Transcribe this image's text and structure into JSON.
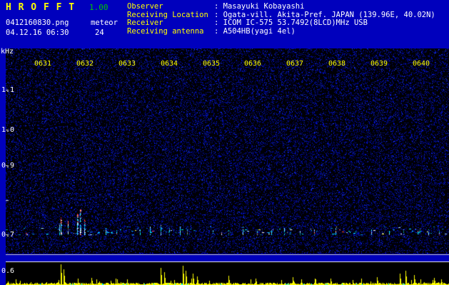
{
  "app": {
    "title": "H R O F F T",
    "version": "1.00",
    "filename": "0412160830.png",
    "mode_label": "meteor",
    "datetime": "04.12.16 06:30",
    "echo_count": "24"
  },
  "observer_info": {
    "rows": [
      {
        "label": "Observer",
        "value": ": Masayuki Kobayashi"
      },
      {
        "label": "Receiving Location",
        "value": ": Ogata-vill. Akita-Pref. JAPAN (139.96E, 40.02N)"
      },
      {
        "label": "Receiver",
        "value": ": ICOM IC-575 53.7492(8LCD)MHz USB"
      },
      {
        "label": "Receiving antenna",
        "value": ": A504HB(yagi 4el)"
      }
    ]
  },
  "spectrogram": {
    "unit_label": "kHz",
    "time_labels": [
      "0631",
      "0632",
      "0633",
      "0634",
      "0635",
      "0636",
      "0637",
      "0638",
      "0639",
      "0640"
    ],
    "freq_labels": [
      "1.1",
      "1.0",
      "0.9",
      "0.7"
    ],
    "bottom_freq_label": "0.6"
  },
  "colors": {
    "background_blue": "#0000bd",
    "label_yellow": "#ffff00",
    "value_white": "#ffffff",
    "version_green": "#00c800",
    "noise_blue": "#0000ff",
    "echo_cyan": "#00ffff",
    "echo_red": "#ff4040",
    "signal_yellow": "#ffff00"
  }
}
